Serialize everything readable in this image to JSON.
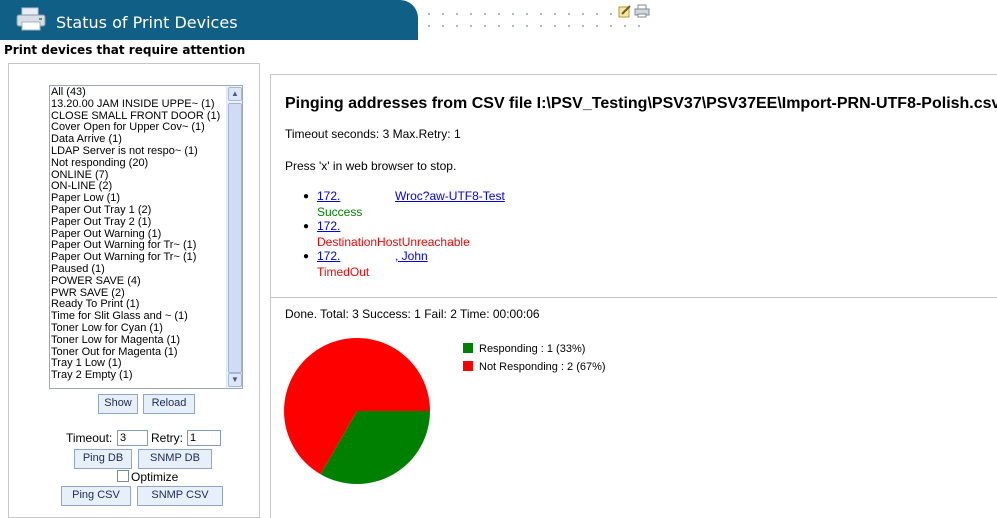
{
  "header": {
    "title": "Status of Print Devices",
    "subtitle": "Print devices that require attention",
    "banner_color": "#0f5f87"
  },
  "left": {
    "list_items": [
      "All (43)",
      "13.20.00 JAM INSIDE UPPE~ (1)",
      "CLOSE SMALL FRONT DOOR (1)",
      "Cover Open for Upper Cov~ (1)",
      "Data Arrive (1)",
      "LDAP Server is not respo~ (1)",
      "Not responding (20)",
      "ONLINE (7)",
      "ON-LINE (2)",
      "Paper Low (1)",
      "Paper Out Tray 1 (2)",
      "Paper Out Tray 2 (1)",
      "Paper Out Warning (1)",
      "Paper Out Warning for Tr~ (1)",
      "Paper Out Warning for Tr~ (1)",
      "Paused (1)",
      "POWER SAVE (4)",
      "PWR SAVE (2)",
      "Ready To Print (1)",
      "Time for Slit Glass and ~ (1)",
      "Toner Low for Cyan (1)",
      "Toner Low for Magenta (1)",
      "Toner Out for Magenta (1)",
      "Tray 1 Low (1)",
      "Tray 2 Empty (1)"
    ],
    "show_label": "Show",
    "reload_label": "Reload",
    "timeout_label": "Timeout:",
    "timeout_value": "3",
    "retry_label": "Retry:",
    "retry_value": "1",
    "ping_db_label": "Ping DB",
    "snmp_db_label": "SNMP DB",
    "optimize_label": "Optimize",
    "ping_csv_label": "Ping CSV",
    "snmp_csv_label": "SNMP CSV"
  },
  "right": {
    "title": "Pinging addresses from CSV file I:\\PSV_Testing\\PSV37\\PSV37EE\\Import-PRN-UTF8-Polish.csv",
    "timeout_line": "Timeout seconds: 3 Max.Retry: 1",
    "press_line": "Press 'x' in web browser to stop.",
    "results": [
      {
        "ip": "172.",
        "name": "Wroc?aw-UTF8-Test",
        "status": "Success"
      },
      {
        "ip": "172.",
        "name": "",
        "status": "DestinationHostUnreachable"
      },
      {
        "ip": "172.",
        "name": ", John",
        "status": "TimedOut"
      }
    ],
    "done_line": "Done. Total: 3 Success: 1 Fail: 2 Time: 00:00:06"
  },
  "chart_data": {
    "type": "pie",
    "slices": [
      {
        "label": "Responding : 1 (33%)",
        "value": 1,
        "color": "#008000"
      },
      {
        "label": "Not Responding : 2 (67%)",
        "value": 2,
        "color": "#ff0000"
      }
    ],
    "legend_position": "right"
  },
  "colors": {
    "success": "#008000",
    "fail": "#ff0000",
    "link": "#0000ee"
  }
}
